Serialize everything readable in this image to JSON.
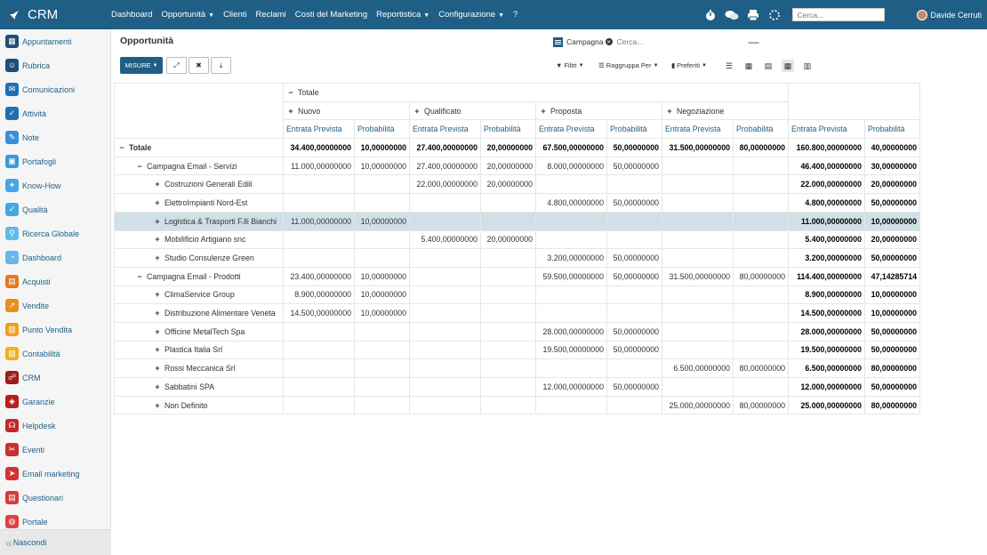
{
  "app": {
    "name": "CRM"
  },
  "topnav": [
    {
      "label": "Dashboard",
      "dropdown": false
    },
    {
      "label": "Opportunità",
      "dropdown": true
    },
    {
      "label": "Clienti",
      "dropdown": false
    },
    {
      "label": "Reclami",
      "dropdown": false
    },
    {
      "label": "Costi del Marketing",
      "dropdown": false
    },
    {
      "label": "Reportistica",
      "dropdown": true
    },
    {
      "label": "Configurazione",
      "dropdown": true
    },
    {
      "label": "?",
      "dropdown": false
    }
  ],
  "search": {
    "placeholder": "Cerca..."
  },
  "user": {
    "name": "Davide Cerruti"
  },
  "sidebar": [
    {
      "label": "Appuntamenti",
      "color": "#1f4e79",
      "icon": "calendar-icon",
      "glyph": "▦"
    },
    {
      "label": "Rubrica",
      "color": "#1f4e79",
      "icon": "contacts-icon",
      "glyph": "☺"
    },
    {
      "label": "Comunicazioni",
      "color": "#1f6fb5",
      "icon": "chat-icon",
      "glyph": "✉"
    },
    {
      "label": "Attività",
      "color": "#1f6fb5",
      "icon": "check-icon",
      "glyph": "✓"
    },
    {
      "label": "Note",
      "color": "#3a8dd8",
      "icon": "note-icon",
      "glyph": "✎"
    },
    {
      "label": "Portafogli",
      "color": "#3a9ad8",
      "icon": "wallet-icon",
      "glyph": "▣"
    },
    {
      "label": "Know-How",
      "color": "#45a8e0",
      "icon": "bulb-icon",
      "glyph": "✦"
    },
    {
      "label": "Qualità",
      "color": "#45a8e0",
      "icon": "quality-icon",
      "glyph": "✓"
    },
    {
      "label": "Ricerca Globale",
      "color": "#64b8e8",
      "icon": "search-icon",
      "glyph": "⚲"
    },
    {
      "label": "Dashboard",
      "color": "#64b8e8",
      "icon": "dashboard-icon",
      "glyph": "◔"
    },
    {
      "label": "Acquisti",
      "color": "#e07b1f",
      "icon": "cart-icon",
      "glyph": "▤"
    },
    {
      "label": "Vendite",
      "color": "#e8901f",
      "icon": "sales-icon",
      "glyph": "↗"
    },
    {
      "label": "Punto Vendita",
      "color": "#f0a020",
      "icon": "pos-icon",
      "glyph": "▥"
    },
    {
      "label": "Contabilità",
      "color": "#f0b020",
      "icon": "accounting-icon",
      "glyph": "▧"
    },
    {
      "label": "CRM",
      "color": "#9e1b1b",
      "icon": "crm-icon",
      "glyph": "☍"
    },
    {
      "label": "Garanzie",
      "color": "#b51f1f",
      "icon": "shield-icon",
      "glyph": "◈"
    },
    {
      "label": "Helpdesk",
      "color": "#c0282a",
      "icon": "headset-icon",
      "glyph": "☊"
    },
    {
      "label": "Eventi",
      "color": "#c83030",
      "icon": "ticket-icon",
      "glyph": "✂"
    },
    {
      "label": "Email marketing",
      "color": "#d03535",
      "icon": "send-icon",
      "glyph": "➤"
    },
    {
      "label": "Questionari",
      "color": "#d83a3a",
      "icon": "survey-icon",
      "glyph": "▤"
    },
    {
      "label": "Portale",
      "color": "#e04040",
      "icon": "globe-icon",
      "glyph": "◍"
    }
  ],
  "sidebar_hide": "Nascondi",
  "page": {
    "title": "Opportunità",
    "facet_label": "Campagna",
    "search_placeholder": "Cerca...",
    "misure": "MISURE",
    "filters": "Filtri",
    "groupby": "Raggruppa Per",
    "favorites": "Preferiti"
  },
  "pivot": {
    "total_label": "Totale",
    "stages": [
      "Nuovo",
      "Qualificato",
      "Proposta",
      "Negoziazione"
    ],
    "measures": [
      "Entrata Prevista",
      "Probabilità"
    ],
    "rows": [
      {
        "label": "Totale",
        "level": 0,
        "sign": "−",
        "bold": true,
        "cells": [
          "34.400,00000000",
          "10,00000000",
          "27.400,00000000",
          "20,00000000",
          "67.500,00000000",
          "50,00000000",
          "31.500,00000000",
          "80,00000000",
          "160.800,00000000",
          "40,00000000"
        ]
      },
      {
        "label": "Campagna Email - Servizi",
        "level": 1,
        "sign": "−",
        "cells": [
          "11.000,00000000",
          "10,00000000",
          "27.400,00000000",
          "20,00000000",
          "8.000,00000000",
          "50,00000000",
          "",
          "",
          "46.400,00000000",
          "30,00000000"
        ]
      },
      {
        "label": "Costruzioni Generali Edili",
        "level": 2,
        "sign": "+",
        "cells": [
          "",
          "",
          "22.000,00000000",
          "20,00000000",
          "",
          "",
          "",
          "",
          "22.000,00000000",
          "20,00000000"
        ]
      },
      {
        "label": "ElettroImpianti Nord-Est",
        "level": 2,
        "sign": "+",
        "cells": [
          "",
          "",
          "",
          "",
          "4.800,00000000",
          "50,00000000",
          "",
          "",
          "4.800,00000000",
          "50,00000000"
        ]
      },
      {
        "label": "Logistica & Trasporti F.lli Bianchi",
        "level": 2,
        "sign": "+",
        "selected": true,
        "cells": [
          "11.000,00000000",
          "10,00000000",
          "",
          "",
          "",
          "",
          "",
          "",
          "11.000,00000000",
          "10,00000000"
        ]
      },
      {
        "label": "Mobilificio Artigiano snc",
        "level": 2,
        "sign": "+",
        "cells": [
          "",
          "",
          "5.400,00000000",
          "20,00000000",
          "",
          "",
          "",
          "",
          "5.400,00000000",
          "20,00000000"
        ]
      },
      {
        "label": "Studio Consulenze Green",
        "level": 2,
        "sign": "+",
        "cells": [
          "",
          "",
          "",
          "",
          "3.200,00000000",
          "50,00000000",
          "",
          "",
          "3.200,00000000",
          "50,00000000"
        ]
      },
      {
        "label": "Campagna Email - Prodotti",
        "level": 1,
        "sign": "−",
        "cells": [
          "23.400,00000000",
          "10,00000000",
          "",
          "",
          "59.500,00000000",
          "50,00000000",
          "31.500,00000000",
          "80,00000000",
          "114.400,00000000",
          "47,14285714"
        ]
      },
      {
        "label": "ClimaService Group",
        "level": 2,
        "sign": "+",
        "cells": [
          "8.900,00000000",
          "10,00000000",
          "",
          "",
          "",
          "",
          "",
          "",
          "8.900,00000000",
          "10,00000000"
        ]
      },
      {
        "label": "Distribuzione Alimentare Veneta",
        "level": 2,
        "sign": "+",
        "cells": [
          "14.500,00000000",
          "10,00000000",
          "",
          "",
          "",
          "",
          "",
          "",
          "14.500,00000000",
          "10,00000000"
        ]
      },
      {
        "label": "Officine MetalTech Spa",
        "level": 2,
        "sign": "+",
        "cells": [
          "",
          "",
          "",
          "",
          "28.000,00000000",
          "50,00000000",
          "",
          "",
          "28.000,00000000",
          "50,00000000"
        ]
      },
      {
        "label": "Plastica Italia Srl",
        "level": 2,
        "sign": "+",
        "cells": [
          "",
          "",
          "",
          "",
          "19.500,00000000",
          "50,00000000",
          "",
          "",
          "19.500,00000000",
          "50,00000000"
        ]
      },
      {
        "label": "Rossi Meccanica Srl",
        "level": 2,
        "sign": "+",
        "cells": [
          "",
          "",
          "",
          "",
          "",
          "",
          "6.500,00000000",
          "80,00000000",
          "6.500,00000000",
          "80,00000000"
        ]
      },
      {
        "label": "Sabbatini SPA",
        "level": 2,
        "sign": "+",
        "cells": [
          "",
          "",
          "",
          "",
          "12.000,00000000",
          "50,00000000",
          "",
          "",
          "12.000,00000000",
          "50,00000000"
        ]
      },
      {
        "label": "Non Definito",
        "level": 2,
        "sign": "+",
        "cells": [
          "",
          "",
          "",
          "",
          "",
          "",
          "25.000,00000000",
          "80,00000000",
          "25.000,00000000",
          "80,00000000"
        ]
      }
    ]
  }
}
